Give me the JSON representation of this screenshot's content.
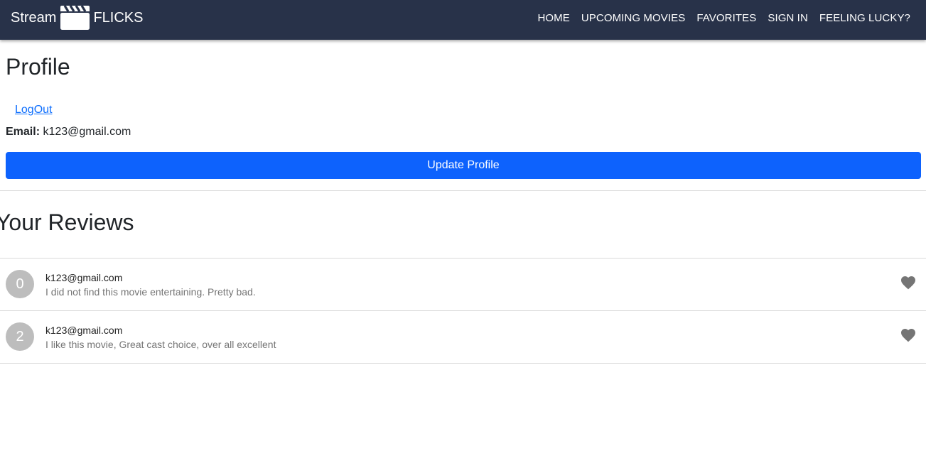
{
  "navbar": {
    "brand_left": "Stream",
    "brand_right": "FLICKS",
    "brand_icon": "clapperboard-icon",
    "links": [
      "HOME",
      "UPCOMING MOVIES",
      "FAVORITES",
      "SIGN IN",
      "FEELING LUCKY?"
    ]
  },
  "profile": {
    "title": "Profile",
    "logout_label": "LogOut",
    "email_label": "Email:",
    "email_value": "k123@gmail.com",
    "update_button_label": "Update Profile"
  },
  "reviews": {
    "title": "Your Reviews",
    "items": [
      {
        "avatar": "0",
        "author": "k123@gmail.com",
        "text": "I did not find this movie entertaining. Pretty bad.",
        "icon": "heart-icon"
      },
      {
        "avatar": "2",
        "author": "k123@gmail.com",
        "text": "I like this movie, Great cast choice, over all excellent",
        "icon": "heart-icon"
      }
    ]
  },
  "colors": {
    "navbar_bg": "#283249",
    "primary_button": "#0d62fd",
    "link": "#0d6efd",
    "avatar_bg": "#bdbdbd",
    "heart": "#757575"
  }
}
